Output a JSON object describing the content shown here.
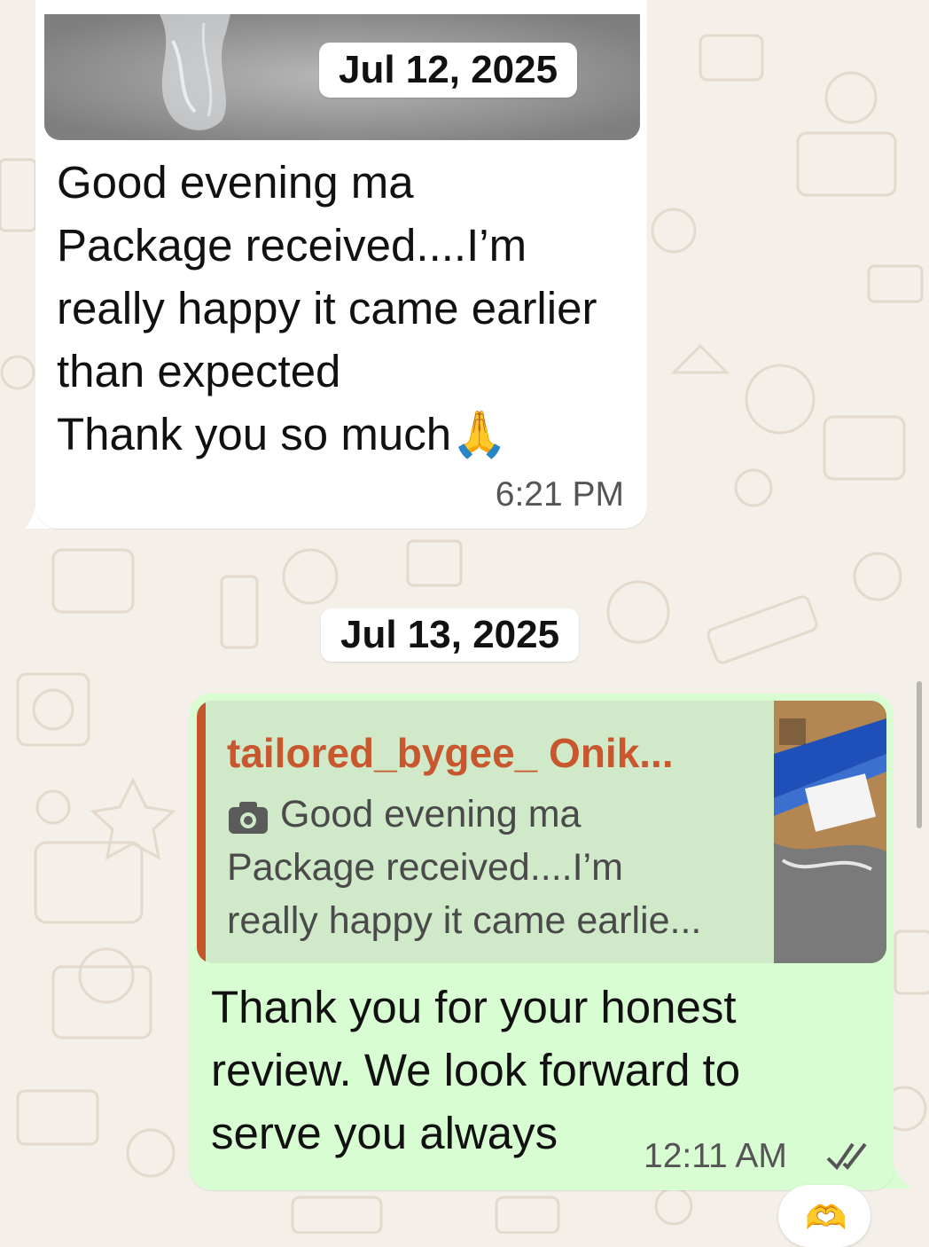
{
  "chat": {
    "date_jul12": "Jul 12, 2025",
    "date_jul13": "Jul 13, 2025"
  },
  "incoming_message": {
    "text": "Good evening ma\nPackage received....I’m really happy it came earlier than expected\nThank you so much🙏",
    "time": "6:21 PM"
  },
  "outgoing_message": {
    "quote_author": "tailored_bygee_ Onik...",
    "quote_line1": "Good evening ma",
    "quote_line2": "Package received....I’m",
    "quote_line3": "really happy it came earlie...",
    "text": "Thank you for your honest review. We look forward to serve you always",
    "time": "12:11 AM",
    "status_icon": "double-check-icon"
  },
  "reaction": {
    "emoji": "🫶"
  },
  "colors": {
    "background": "#f4efe8",
    "incoming_bubble": "#ffffff",
    "outgoing_bubble": "#d9fdd3",
    "quote_accent": "#c9572d"
  }
}
